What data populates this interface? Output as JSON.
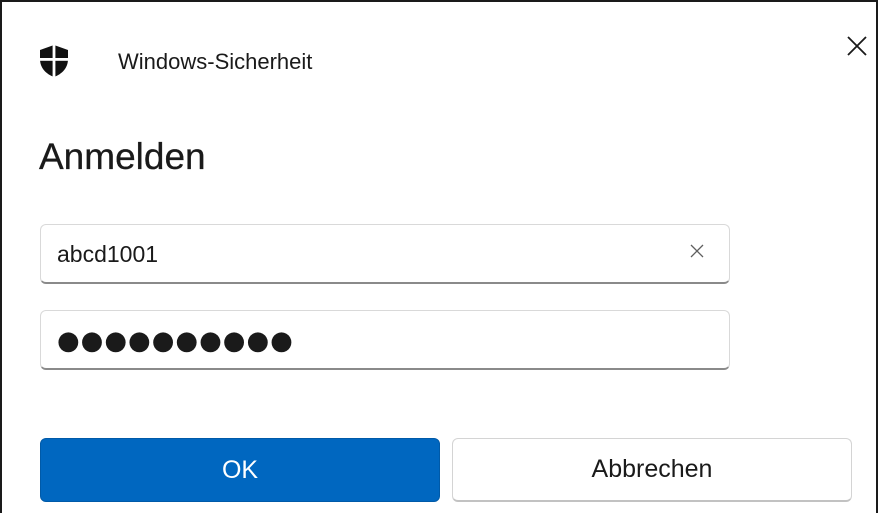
{
  "window": {
    "title": "Windows-Sicherheit",
    "icon": "shield-icon"
  },
  "heading": "Anmelden",
  "username": {
    "value": "abcd1001"
  },
  "password": {
    "value": "●●●●●●●●●●"
  },
  "buttons": {
    "ok_label": "OK",
    "cancel_label": "Abbrechen"
  },
  "colors": {
    "accent": "#0067c0"
  }
}
